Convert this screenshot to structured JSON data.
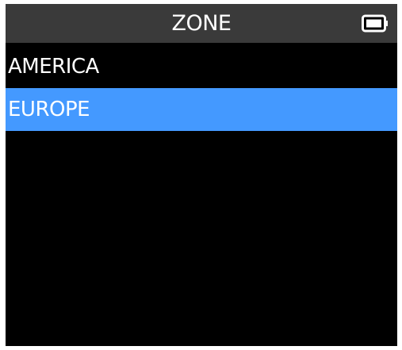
{
  "header": {
    "title": "ZONE",
    "battery_icon": "battery-icon"
  },
  "menu": {
    "items": [
      {
        "label": "AMERICA",
        "selected": false
      },
      {
        "label": "EUROPE",
        "selected": true
      }
    ]
  },
  "colors": {
    "screen_bg": "#000000",
    "titlebar_bg": "#3a3a3a",
    "selection_bg": "#4499ff",
    "text": "#ffffff"
  }
}
